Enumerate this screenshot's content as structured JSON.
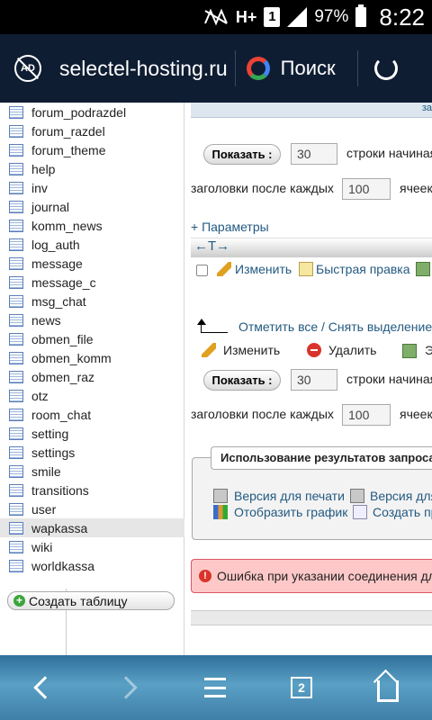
{
  "status_bar": {
    "network": "H+",
    "sim": "1",
    "battery": "97%",
    "time": "8:22"
  },
  "browser": {
    "url": "selectel-hosting.ru",
    "search_label": "Поиск",
    "tab_count": "2"
  },
  "sidebar": {
    "tables": [
      "forum_podrazdel",
      "forum_razdel",
      "forum_theme",
      "help",
      "inv",
      "journal",
      "komm_news",
      "log_auth",
      "message",
      "message_c",
      "msg_chat",
      "news",
      "obmen_file",
      "obmen_komm",
      "obmen_raz",
      "otz",
      "room_chat",
      "setting",
      "settings",
      "smile",
      "transitions",
      "user",
      "wapkassa",
      "wiki",
      "worldkassa"
    ],
    "active_table": "wapkassa",
    "create_table": "Создать таблицу"
  },
  "main": {
    "top_link": "за",
    "show_button": "Показать :",
    "rows_value": "30",
    "rows_start_text": "строки начиная",
    "headers_after_text": "заголовки после каждых",
    "headers_value": "100",
    "cells_text": "ячеек",
    "params_link": "+ Параметры",
    "row_actions": {
      "edit": "Изменить",
      "quick_edit": "Быстрая правка"
    },
    "check_all": "Отметить все / Снять выделение",
    "bulk_actions": {
      "edit": "Изменить",
      "delete": "Удалить",
      "export": "Э"
    },
    "query_results": {
      "legend": "Использование результатов запроса",
      "print_version": "Версия для печати",
      "print_version_full": "Версия для",
      "show_chart": "Отобразить график",
      "create_view": "Создать пр"
    },
    "error_text": "Ошибка при указании соединения для"
  }
}
